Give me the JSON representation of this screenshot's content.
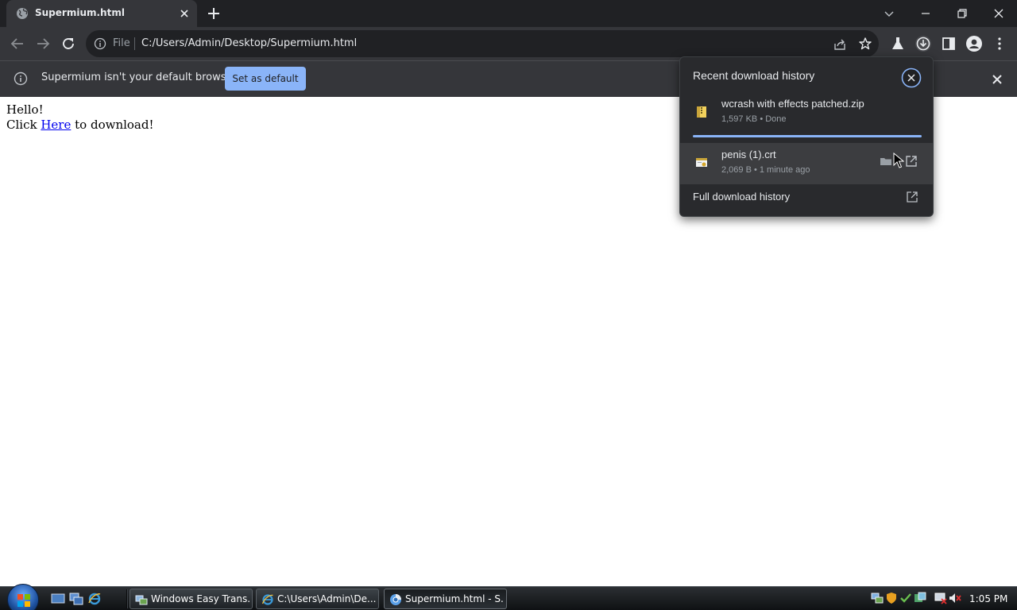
{
  "browser": {
    "tab": {
      "title": "Supermium.html"
    },
    "omnibox": {
      "scheme": "File",
      "url": "C:/Users/Admin/Desktop/Supermium.html"
    },
    "infobar": {
      "message": "Supermium isn't your default browser",
      "button": "Set as default"
    }
  },
  "page": {
    "line1": "Hello!",
    "click_prefix": "Click",
    "link_text": "Here",
    "click_suffix": "to download!"
  },
  "downloads": {
    "title": "Recent download history",
    "items": [
      {
        "name": "wcrash with effects patched.zip",
        "meta": "1,597 KB • Done",
        "icon": "zip-file-icon",
        "progress": 1.0
      },
      {
        "name": "penis (1).crt",
        "meta": "2,069 B • 1 minute ago",
        "icon": "certificate-file-icon"
      }
    ],
    "footer": "Full download history"
  },
  "taskbar": {
    "buttons": [
      {
        "label": "Windows Easy Trans...",
        "icon": "easy-transfer-icon"
      },
      {
        "label": "C:\\Users\\Admin\\De...",
        "icon": "ie-icon"
      },
      {
        "label": "Supermium.html - S...",
        "icon": "supermium-icon"
      }
    ],
    "clock": "1:05 PM"
  },
  "colors": {
    "accent": "#8ab4f8",
    "toolbar": "#35363a",
    "tabstrip": "#202124",
    "link": "#0000ee"
  }
}
